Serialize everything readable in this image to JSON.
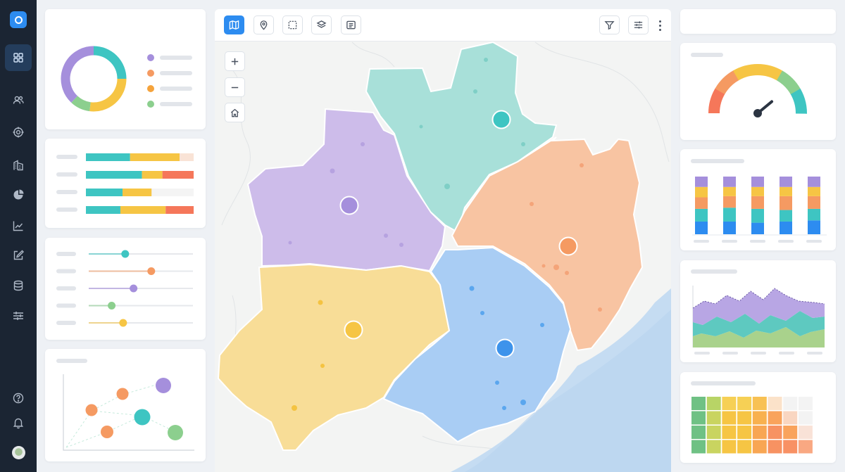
{
  "sidebar": {
    "nav": [
      {
        "icon": "grid-icon",
        "active": true
      },
      {
        "icon": "users-icon"
      },
      {
        "icon": "target-icon"
      },
      {
        "icon": "building-icon"
      },
      {
        "icon": "pie-chart-icon"
      },
      {
        "icon": "line-chart-icon"
      },
      {
        "icon": "edit-icon"
      },
      {
        "icon": "database-icon"
      },
      {
        "icon": "sliders-icon"
      }
    ],
    "bottom": [
      {
        "icon": "help-icon"
      },
      {
        "icon": "bell-icon"
      }
    ]
  },
  "colors": {
    "purple": "#a58fdc",
    "teal": "#3ec5c2",
    "yellow": "#f6c544",
    "orange": "#f59a62",
    "blue": "#3d93eb",
    "green": "#8ccf8e",
    "accent": "#2d8cf0",
    "sidebar": "#1b2533"
  },
  "map": {
    "toolbar_left": [
      "map-icon",
      "pin-icon",
      "select-box-icon",
      "layers-icon",
      "list-icon"
    ],
    "toolbar_right": [
      "filter-icon",
      "sliders-icon",
      "more-icon"
    ],
    "controls": [
      "zoom-in-icon",
      "zoom-out-icon",
      "home-icon"
    ],
    "regions": [
      {
        "color": "#a58fdc"
      },
      {
        "color": "#3ec5c2"
      },
      {
        "color": "#f59a62"
      },
      {
        "color": "#f6c544"
      },
      {
        "color": "#3d93eb"
      }
    ]
  },
  "widgets": {
    "donut": {
      "segments": [
        0.25,
        0.27,
        0.1,
        0.38
      ],
      "colors": [
        "#3ec5c2",
        "#f6c544",
        "#8ccf8e",
        "#a58fdc"
      ],
      "legend_colors": [
        "#a58fdc",
        "#f59a62",
        "#f5a33c",
        "#8ccf8e"
      ]
    },
    "stacked_bars": [
      [
        0.41,
        0.46,
        0.13
      ],
      [
        0.52,
        0.19,
        0.29
      ],
      [
        0.34,
        0.27,
        0.39
      ],
      [
        0.32,
        0.42,
        0.26
      ]
    ],
    "sliders": [
      0.35,
      0.6,
      0.43,
      0.22,
      0.33
    ],
    "gauge": {
      "value": 0.78
    },
    "columns": [
      [
        0.22,
        0.22,
        0.2,
        0.18,
        0.18
      ],
      [
        0.22,
        0.24,
        0.2,
        0.16,
        0.18
      ],
      [
        0.2,
        0.24,
        0.22,
        0.16,
        0.18
      ],
      [
        0.22,
        0.2,
        0.24,
        0.16,
        0.18
      ],
      [
        0.24,
        0.2,
        0.22,
        0.16,
        0.18
      ]
    ]
  }
}
